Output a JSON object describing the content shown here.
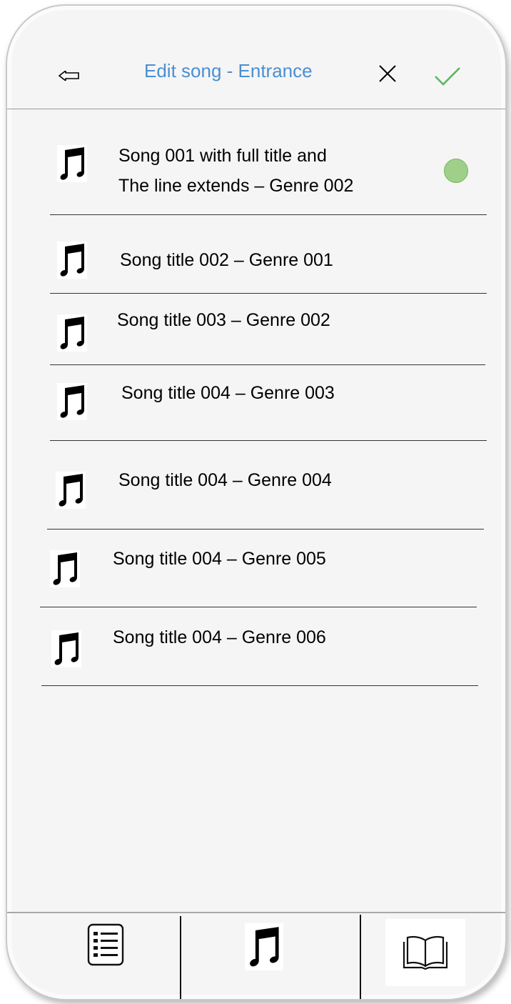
{
  "header": {
    "title": "Edit song - Entrance",
    "back_icon": "back-arrow-icon",
    "cancel_icon": "close-icon",
    "confirm_icon": "checkmark-icon",
    "title_color": "#4a8fd2",
    "confirm_color": "#5cb85c"
  },
  "songs": [
    {
      "line1": "Song 001 with full title and",
      "line2": "The line extends – Genre 002",
      "selected": true
    },
    {
      "line1": "Song title 002 – Genre 001"
    },
    {
      "line1": "Song title 003 – Genre 002"
    },
    {
      "line1": "Song title 004 – Genre 003"
    },
    {
      "line1": "Song title 004 – Genre 004"
    },
    {
      "line1": "Song title 004 – Genre 005"
    },
    {
      "line1": "Song title 004 – Genre 006"
    }
  ],
  "tabbar": {
    "tabs": [
      {
        "icon": "list-icon"
      },
      {
        "icon": "music-note-icon"
      },
      {
        "icon": "book-icon"
      }
    ]
  },
  "colors": {
    "selected_dot": "#9fd08a"
  }
}
